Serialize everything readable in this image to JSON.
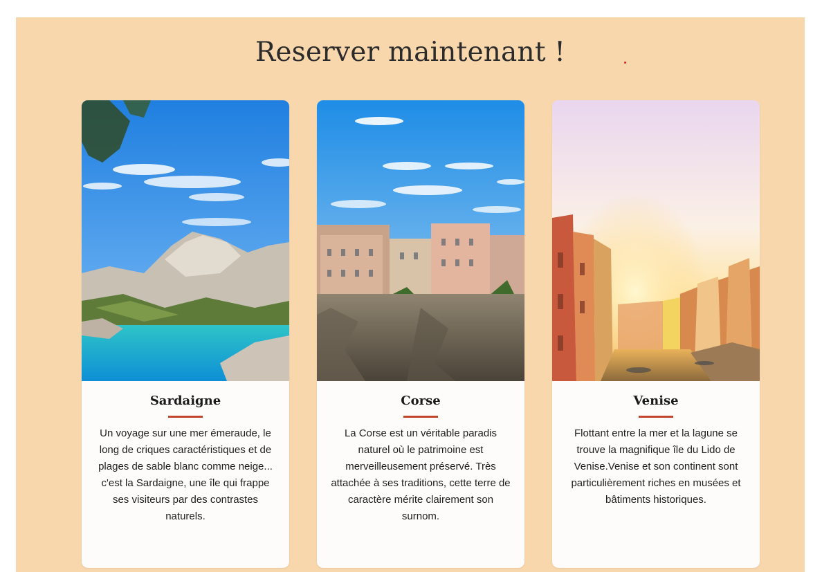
{
  "section": {
    "title": "Reserver maintenant !"
  },
  "cards": [
    {
      "title": "Sardaigne",
      "text": "Un voyage sur une mer émeraude, le long de criques caractéristiques et de plages de sable blanc comme neige... c'est la Sardaigne, une île qui frappe ses visiteurs par des contrastes naturels.",
      "image": "sardinia-coast-photo"
    },
    {
      "title": "Corse",
      "text": "La Corse est un véritable paradis naturel où le patrimoine est merveilleusement préservé. Très attachée à ses traditions, cette terre de caractère mérite clairement son surnom.",
      "image": "corsica-cliff-town-photo"
    },
    {
      "title": "Venise",
      "text": "Flottant entre la mer et la lagune se trouve la magnifique île du Lido de Venise.Venise et son continent sont particulièrement riches en musées et bâtiments historiques.",
      "image": "venice-canal-sunset-photo"
    }
  ],
  "colors": {
    "background": "#f8d7ad",
    "card": "#fdfcfb",
    "accent": "#c0452b"
  }
}
